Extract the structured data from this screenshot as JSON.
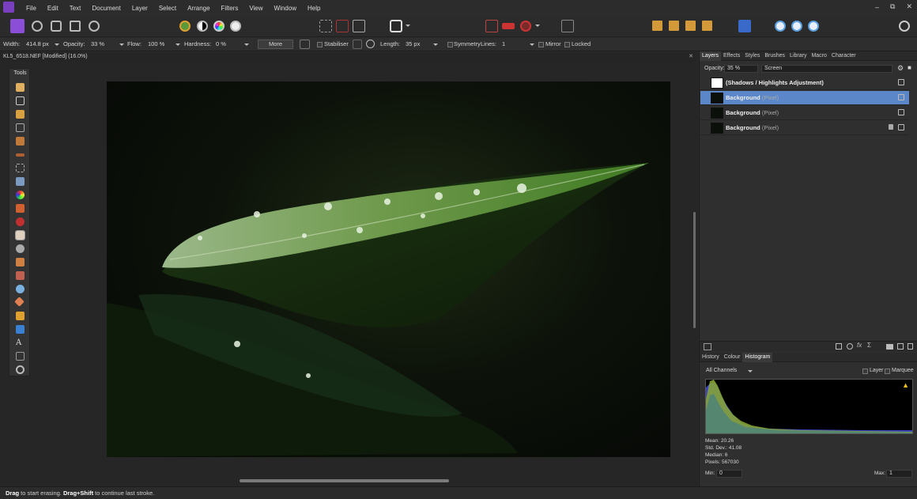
{
  "menubar": {
    "items": [
      "File",
      "Edit",
      "Text",
      "Document",
      "Layer",
      "Select",
      "Arrange",
      "Filters",
      "View",
      "Window",
      "Help"
    ],
    "window_controls": [
      "–",
      "⧉",
      "✕"
    ]
  },
  "context": {
    "width_label": "Width:",
    "width_value": "414.8 px",
    "opacity_label": "Opacity:",
    "opacity_value": "33 %",
    "flow_label": "Flow:",
    "flow_value": "100 %",
    "hardness_label": "Hardness:",
    "hardness_value": "0 %",
    "more_label": "More",
    "stabiliser_label": "Stabiliser",
    "length_label": "Length:",
    "length_value": "35 px",
    "symmetry_label": "Symmetry",
    "lines_label": "Lines:",
    "lines_value": "1",
    "mirror_label": "Mirror",
    "locked_label": "Locked"
  },
  "document": {
    "title": "KL5_6518.NEF [Modified] (16.0%)",
    "close": "✕"
  },
  "tools": {
    "label": "Tools"
  },
  "status": {
    "drag": "Drag",
    "t1": " to start erasing. ",
    "drag_shift": "Drag+Shift",
    "t2": " to continue last stroke."
  },
  "panel_top": {
    "tabs": [
      "Layers",
      "Effects",
      "Styles",
      "Brushes",
      "Library",
      "Macro",
      "Character"
    ],
    "opacity_label": "Opacity:",
    "opacity_value": "35 %",
    "blend_mode": "Screen"
  },
  "layers": [
    {
      "name": "(Shadows / Highlights Adjustment)",
      "type": "",
      "selected": false,
      "locked": false
    },
    {
      "name": "Background",
      "type": " (Pixel)",
      "selected": true,
      "locked": false
    },
    {
      "name": "Background",
      "type": " (Pixel)",
      "selected": false,
      "locked": false
    },
    {
      "name": "Background",
      "type": " (Pixel)",
      "selected": false,
      "locked": true
    }
  ],
  "panel_bottom": {
    "tabs": [
      "History",
      "Colour",
      "Histogram"
    ],
    "channels": "All Channels",
    "layer_label": "Layer",
    "marquee_label": "Marquee"
  },
  "histogram": {
    "mean": "Mean: 20.26",
    "stddev": "Std. Dev.: 41.08",
    "median": "Median: 6",
    "pixels": "Pixels: 567030",
    "min_label": "Min:",
    "min_value": "0",
    "max_label": "Max:",
    "max_value": "1"
  }
}
